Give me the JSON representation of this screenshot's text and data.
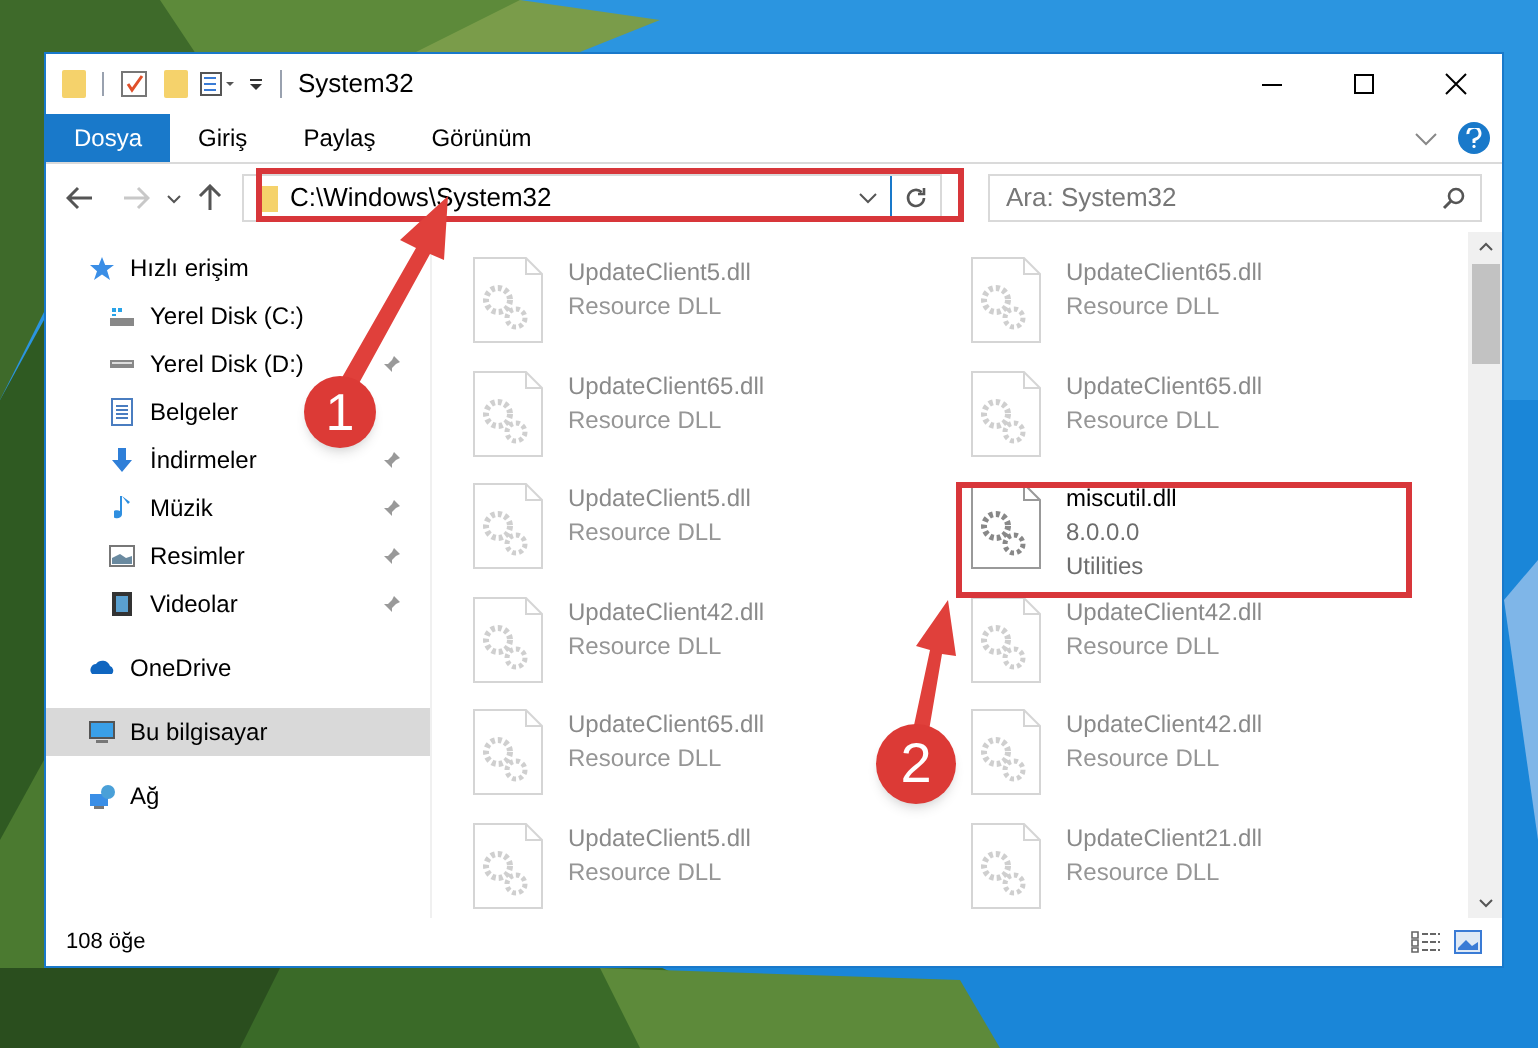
{
  "window": {
    "title": "System32"
  },
  "ribbon_tabs": [
    {
      "label": "Dosya",
      "selected": true
    },
    {
      "label": "Giriş",
      "selected": false
    },
    {
      "label": "Paylaş",
      "selected": false
    },
    {
      "label": "Görünüm",
      "selected": false
    }
  ],
  "address_bar": {
    "path": "C:\\Windows\\System32"
  },
  "search": {
    "placeholder": "Ara: System32"
  },
  "sidebar": {
    "items": [
      {
        "label": "Hızlı erişim",
        "selected": false,
        "children": [
          {
            "label": "Yerel Disk (C:)",
            "pinned": false
          },
          {
            "label": "Yerel Disk (D:)",
            "pinned": true
          },
          {
            "label": "Belgeler",
            "pinned": false
          },
          {
            "label": "İndirmeler",
            "pinned": true
          },
          {
            "label": "Müzik",
            "pinned": true
          },
          {
            "label": "Resimler",
            "pinned": true
          },
          {
            "label": "Videolar",
            "pinned": true
          }
        ]
      },
      {
        "label": "OneDrive",
        "selected": false
      },
      {
        "label": "Bu bilgisayar",
        "selected": true
      },
      {
        "label": "Ağ",
        "selected": false
      }
    ]
  },
  "files": [
    {
      "name": "UpdateClient5.dll",
      "details": [
        "Resource DLL"
      ],
      "faded": true
    },
    {
      "name": "UpdateClient65.dll",
      "details": [
        "Resource DLL"
      ],
      "faded": true
    },
    {
      "name": "UpdateClient65.dll",
      "details": [
        "Resource DLL"
      ],
      "faded": true
    },
    {
      "name": "UpdateClient65.dll",
      "details": [
        "Resource DLL"
      ],
      "faded": true
    },
    {
      "name": "UpdateClient5.dll",
      "details": [
        "Resource DLL"
      ],
      "faded": true
    },
    {
      "name": "miscutil.dll",
      "details": [
        "8.0.0.0",
        "Utilities"
      ],
      "faded": false
    },
    {
      "name": "UpdateClient42.dll",
      "details": [
        "Resource DLL"
      ],
      "faded": true
    },
    {
      "name": "UpdateClient42.dll",
      "details": [
        "Resource DLL"
      ],
      "faded": true
    },
    {
      "name": "UpdateClient65.dll",
      "details": [
        "Resource DLL"
      ],
      "faded": true
    },
    {
      "name": "UpdateClient42.dll",
      "details": [
        "Resource DLL"
      ],
      "faded": true
    },
    {
      "name": "UpdateClient5.dll",
      "details": [
        "Resource DLL"
      ],
      "faded": true
    },
    {
      "name": "UpdateClient21.dll",
      "details": [
        "Resource DLL"
      ],
      "faded": true
    }
  ],
  "status_bar": {
    "count": "108 öğe"
  },
  "annotations": [
    {
      "number": "1"
    },
    {
      "number": "2"
    }
  ]
}
